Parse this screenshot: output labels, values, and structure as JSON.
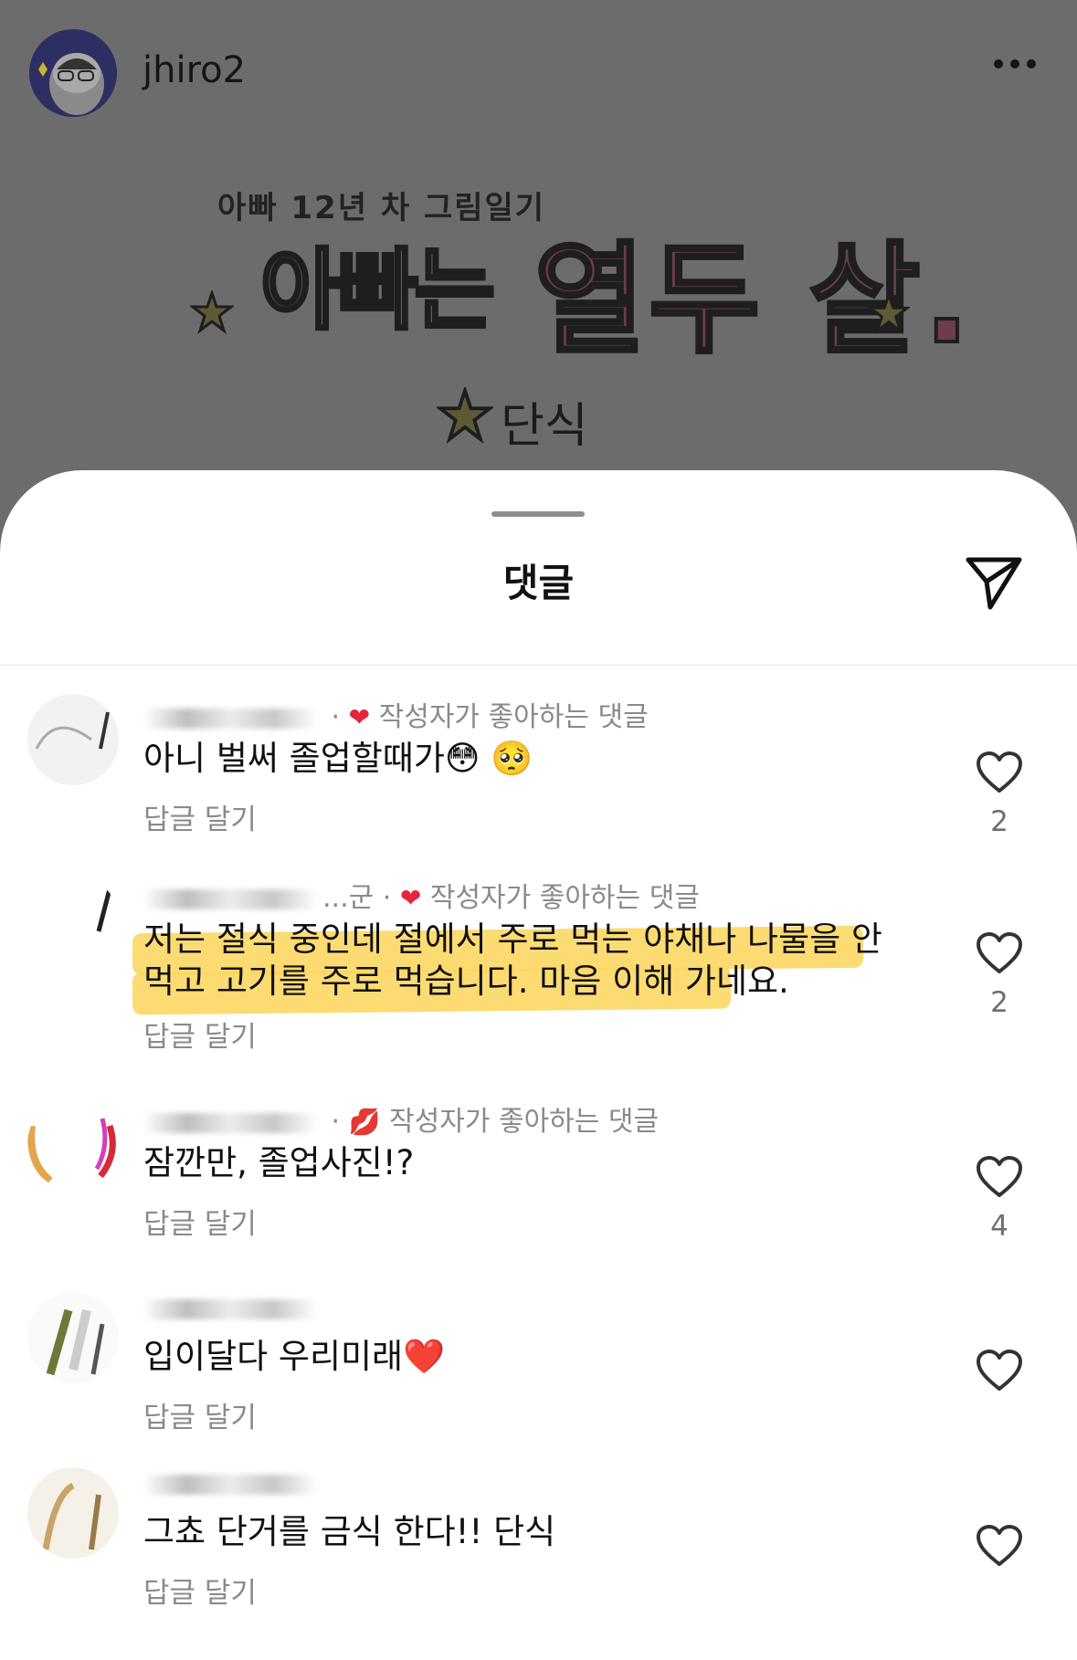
{
  "post": {
    "username": "jhiro2",
    "image": {
      "subtitle": "아빠 12년 차 그림일기",
      "title_part1": "아빠는",
      "title_part2": "열두 살.",
      "chapter": "단식"
    }
  },
  "sheet": {
    "title": "댓글"
  },
  "comments": [
    {
      "author_badge_text": "작성자가 좋아하는 댓글",
      "text": "아니 벌써 졸업할때가😳 🥺",
      "reply_label": "답글 달기",
      "like_count": "2"
    },
    {
      "author_suffix": "...군",
      "author_badge_text": "작성자가 좋아하는 댓글",
      "text": "저는 절식 중인데 절에서 주로 먹는 야채나 나물을 안먹고 고기를 주로 먹습니다. 마음 이해 가네요.",
      "reply_label": "답글 달기",
      "like_count": "2"
    },
    {
      "author_badge_text": "작성자가 좋아하는 댓글",
      "text": "잠깐만, 졸업사진!?",
      "reply_label": "답글 달기",
      "like_count": "4"
    },
    {
      "text": "입이달다 우리미래❤️",
      "reply_label": "답글 달기"
    },
    {
      "text": "그쵸 단거를 금식 한다!! 단식",
      "reply_label": "답글 달기"
    }
  ],
  "colors": {
    "dim_overlay": "#6c6c6c",
    "sheet_bg": "#ffffff",
    "heart_red": "#e4253b",
    "highlight": "#fdd55a",
    "muted_text": "#8a8a8a"
  },
  "icons": [
    "more-icon",
    "share-icon",
    "heart-outline-icon",
    "heart-red-icon",
    "lips-icon",
    "star-icon"
  ]
}
